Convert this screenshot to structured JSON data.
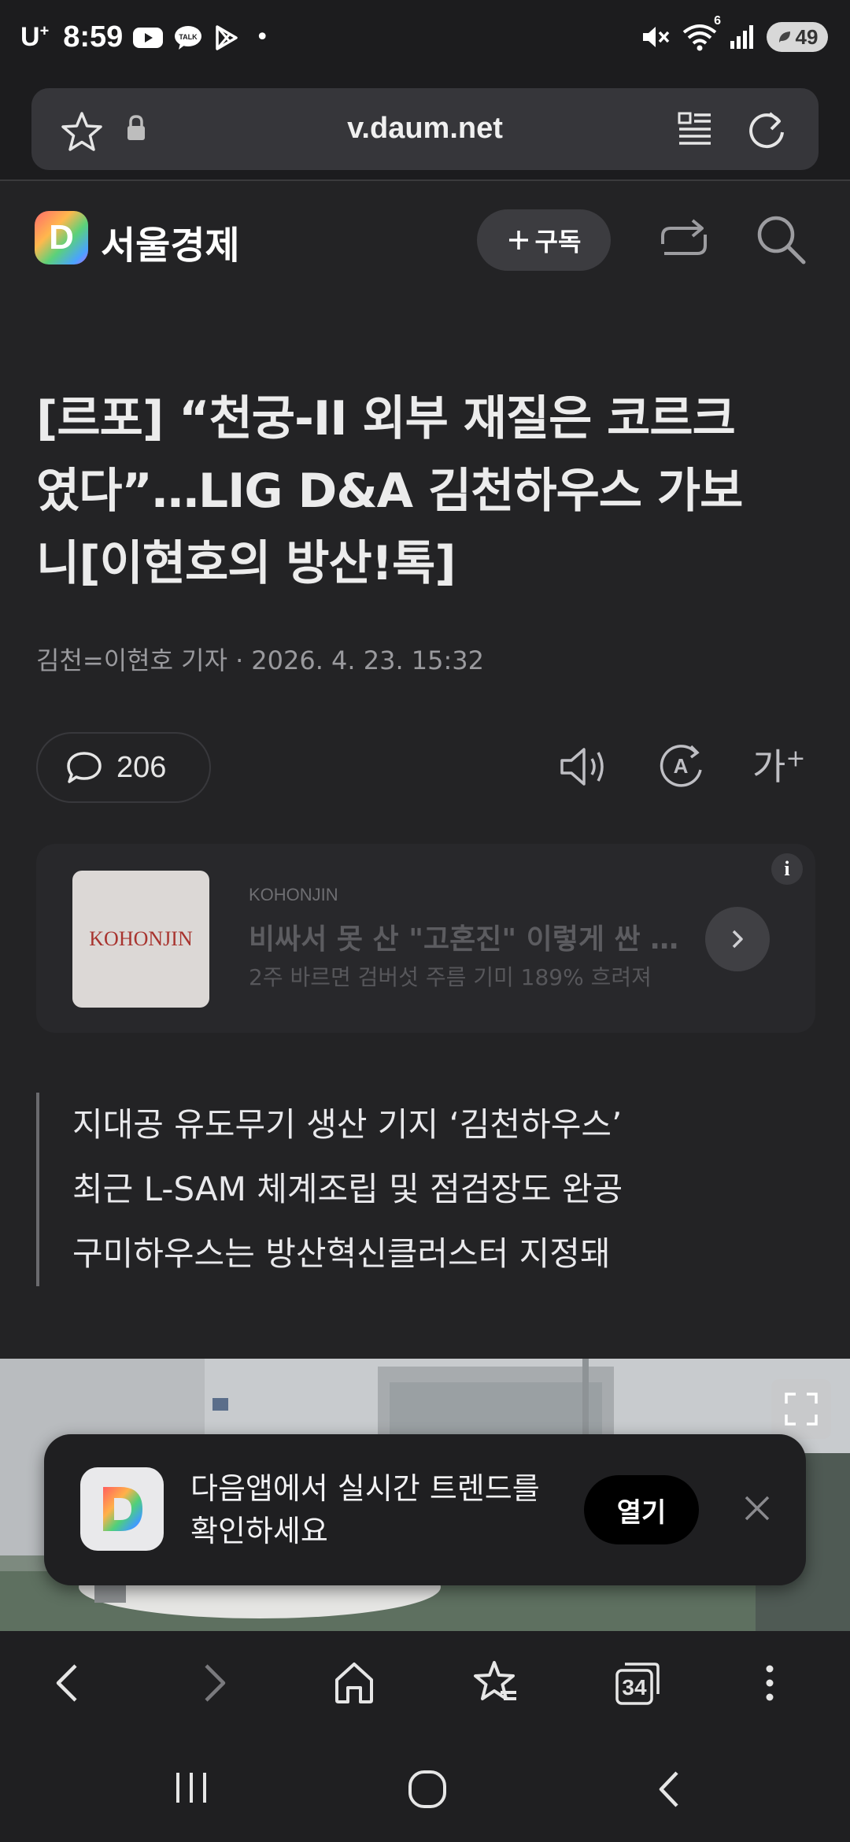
{
  "status_bar": {
    "carrier": "U",
    "carrier_sup": "+",
    "time": "8:59",
    "notification_dot": "•",
    "battery": "49",
    "wifi_badge": "6"
  },
  "url_bar": {
    "url": "v.daum.net"
  },
  "site_header": {
    "logo_letter": "D",
    "site_name": "서울경제",
    "subscribe_label": "구독"
  },
  "article": {
    "headline_lines": [
      "[르포] “천궁-II 외부 재질은 코르크",
      "였다”…LIG D&A 김천하우스 가보",
      "니[이현호의 방산!톡]"
    ],
    "byline_author": "김천=이현호 기자",
    "byline_sep": "·",
    "byline_date": "2026. 4. 23. 15:32",
    "comment_count": "206",
    "fontsize_label": "가",
    "fontsize_plus": "+"
  },
  "ad": {
    "thumb_text": "KOHONJIN",
    "brand": "KOHONJIN",
    "title": "비싸서 못 산 \"고혼진\" 이렇게 싼 이유",
    "desc": "2주 바르면 검버섯 주름 기미 189% 흐려져",
    "info_label": "i"
  },
  "summary": [
    "지대공 유도무기 생산 기지 ‘김천하우스’",
    "최근 L-SAM 체계조립 및 점검장도 완공",
    "구미하우스는 방산혁신클러스터 지정돼"
  ],
  "app_banner": {
    "text_line1": "다음앱에서 실시간 트렌드를",
    "text_line2": "확인하세요",
    "open_label": "열기",
    "logo_letter": "D"
  },
  "toolbar": {
    "tab_count": "34"
  },
  "colors": {
    "background": "#232325",
    "bar_background": "#1c1c1e",
    "text_primary": "#ececec",
    "text_muted": "#9a9a9e"
  }
}
